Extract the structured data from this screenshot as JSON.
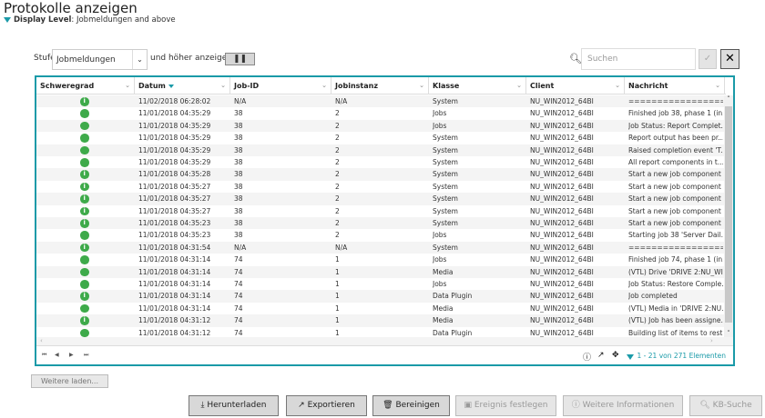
{
  "title": "Protokolle anzeigen",
  "display_level": {
    "label": "Display Level",
    "value": ": Jobmeldungen and above"
  },
  "filter": {
    "stufe_label": "Stufe",
    "selected": "Jobmeldungen",
    "suffix": "und höher anzeigen",
    "pause": "❚❚"
  },
  "search": {
    "placeholder": "Suchen",
    "ok": "✓",
    "clear": "✕"
  },
  "columns": [
    "Schweregrad",
    "Datum",
    "Job-ID",
    "Jobinstanz",
    "Klasse",
    "Client",
    "Nachricht"
  ],
  "rows": [
    [
      "info",
      "11/02/2018 06:28:02",
      "N/A",
      "N/A",
      "System",
      "NU_WIN2012_64BI",
      "=========================..."
    ],
    [
      "dot",
      "11/01/2018 04:35:29",
      "38",
      "2",
      "Jobs",
      "NU_WIN2012_64BI",
      "Finished job 38, phase 1 (in..."
    ],
    [
      "dot",
      "11/01/2018 04:35:29",
      "38",
      "2",
      "Jobs",
      "NU_WIN2012_64BI",
      "Job Status: Report Complet..."
    ],
    [
      "dot",
      "11/01/2018 04:35:29",
      "38",
      "2",
      "System",
      "NU_WIN2012_64BI",
      "Report output has been pr..."
    ],
    [
      "dot",
      "11/01/2018 04:35:29",
      "38",
      "2",
      "System",
      "NU_WIN2012_64BI",
      "Raised completion event 'T..."
    ],
    [
      "dot",
      "11/01/2018 04:35:29",
      "38",
      "2",
      "System",
      "NU_WIN2012_64BI",
      "All report components in t..."
    ],
    [
      "info",
      "11/01/2018 04:35:28",
      "38",
      "2",
      "System",
      "NU_WIN2012_64BI",
      "Start a new job component"
    ],
    [
      "info",
      "11/01/2018 04:35:27",
      "38",
      "2",
      "System",
      "NU_WIN2012_64BI",
      "Start a new job component"
    ],
    [
      "info",
      "11/01/2018 04:35:27",
      "38",
      "2",
      "System",
      "NU_WIN2012_64BI",
      "Start a new job component"
    ],
    [
      "info",
      "11/01/2018 04:35:27",
      "38",
      "2",
      "System",
      "NU_WIN2012_64BI",
      "Start a new job component"
    ],
    [
      "info",
      "11/01/2018 04:35:23",
      "38",
      "2",
      "System",
      "NU_WIN2012_64BI",
      "Start a new job component"
    ],
    [
      "dot",
      "11/01/2018 04:35:23",
      "38",
      "2",
      "Jobs",
      "NU_WIN2012_64BI",
      "Starting job 38 'Server Dail..."
    ],
    [
      "info",
      "11/01/2018 04:31:54",
      "N/A",
      "N/A",
      "System",
      "NU_WIN2012_64BI",
      "=========================..."
    ],
    [
      "dot",
      "11/01/2018 04:31:14",
      "74",
      "1",
      "Jobs",
      "NU_WIN2012_64BI",
      "Finished job 74, phase 1 (in..."
    ],
    [
      "dot",
      "11/01/2018 04:31:14",
      "74",
      "1",
      "Media",
      "NU_WIN2012_64BI",
      "(VTL) Drive 'DRIVE 2:NU_WI..."
    ],
    [
      "dot",
      "11/01/2018 04:31:14",
      "74",
      "1",
      "Jobs",
      "NU_WIN2012_64BI",
      "Job Status: Restore Comple..."
    ],
    [
      "info",
      "11/01/2018 04:31:14",
      "74",
      "1",
      "Data Plugin",
      "NU_WIN2012_64BI",
      "Job completed"
    ],
    [
      "dot",
      "11/01/2018 04:31:14",
      "74",
      "1",
      "Media",
      "NU_WIN2012_64BI",
      "(VTL) Media in 'DRIVE 2:NU..."
    ],
    [
      "info",
      "11/01/2018 04:31:12",
      "74",
      "1",
      "Media",
      "NU_WIN2012_64BI",
      "(VTL) Job has been assigne..."
    ],
    [
      "dot",
      "11/01/2018 04:31:12",
      "74",
      "1",
      "Data Plugin",
      "NU_WIN2012_64BI",
      "Building list of items to rest..."
    ]
  ],
  "pager": {
    "first": "⏮",
    "prev": "◀",
    "next": "▶",
    "last": "⏭",
    "count": "1 - 21 von 271 Elementen"
  },
  "load_more": "Weitere laden...",
  "buttons": [
    "Herunterladen",
    "Exportieren",
    "Bereinigen",
    "Ereignis festlegen",
    "Weitere Informationen",
    "KB-Suche"
  ],
  "colors": {
    "accent": "#1a9aa8",
    "success": "#3eaa4a"
  }
}
